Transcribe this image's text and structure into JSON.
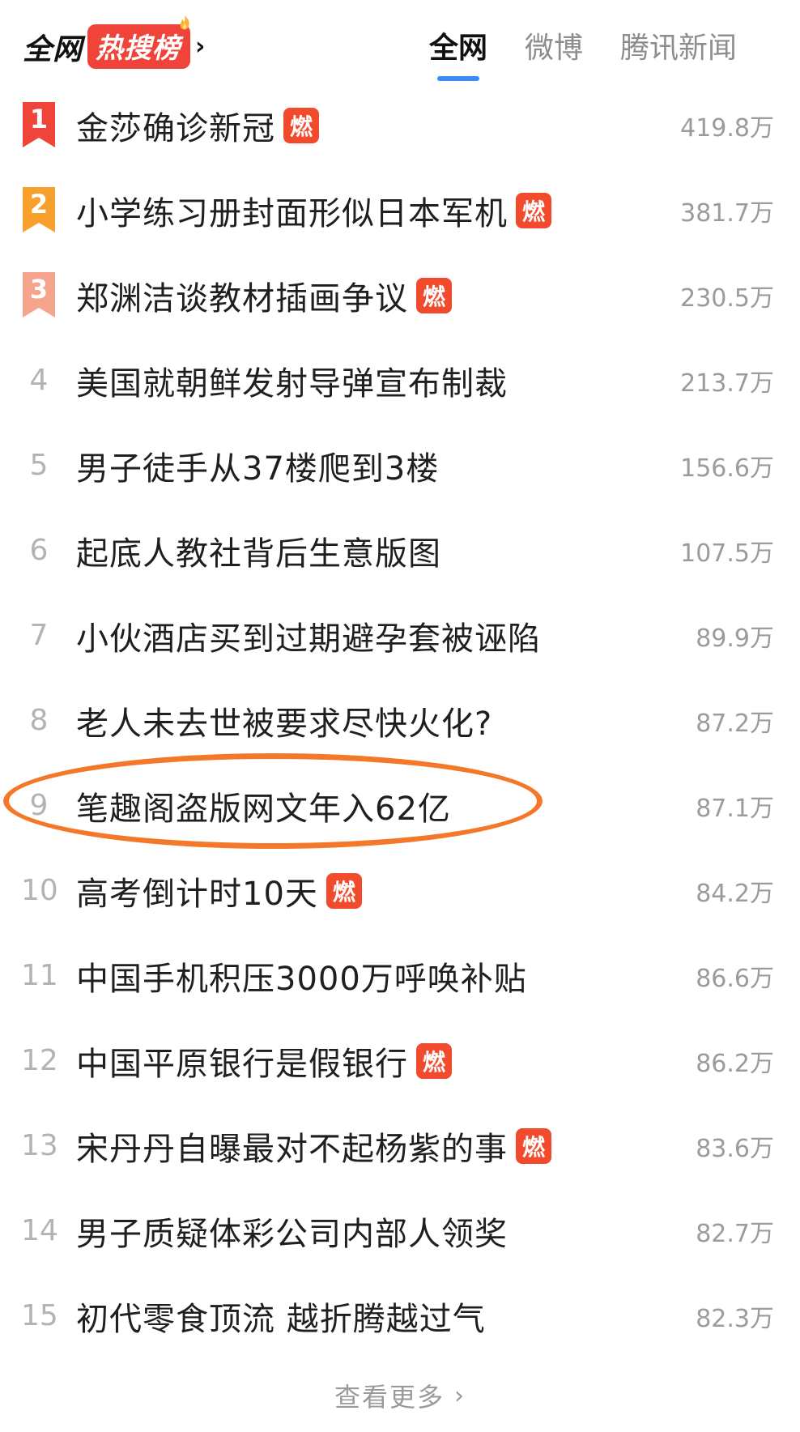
{
  "header": {
    "brand_prefix": "全网",
    "brand_highlight": "热搜榜",
    "brand_chevron": "›",
    "tabs": [
      {
        "label": "全网",
        "active": true
      },
      {
        "label": "微博",
        "active": false
      },
      {
        "label": "腾讯新闻",
        "active": false
      }
    ]
  },
  "badge_label": "燃",
  "colors": {
    "rank1": "#f0433a",
    "rank2": "#f7a12c",
    "rank3": "#f6a48d",
    "hot_badge": "#f24a2c",
    "accent": "#3b8af5",
    "annotation": "#f4782a"
  },
  "items": [
    {
      "rank": "1",
      "title": "金莎确诊新冠",
      "hot": true,
      "count": "419.8万"
    },
    {
      "rank": "2",
      "title": "小学练习册封面形似日本军机",
      "hot": true,
      "count": "381.7万"
    },
    {
      "rank": "3",
      "title": "郑渊洁谈教材插画争议",
      "hot": true,
      "count": "230.5万"
    },
    {
      "rank": "4",
      "title": "美国就朝鲜发射导弹宣布制裁",
      "hot": false,
      "count": "213.7万"
    },
    {
      "rank": "5",
      "title": "男子徒手从37楼爬到3楼",
      "hot": false,
      "count": "156.6万"
    },
    {
      "rank": "6",
      "title": "起底人教社背后生意版图",
      "hot": false,
      "count": "107.5万"
    },
    {
      "rank": "7",
      "title": "小伙酒店买到过期避孕套被诬陷",
      "hot": false,
      "count": "89.9万"
    },
    {
      "rank": "8",
      "title": "老人未去世被要求尽快火化?",
      "hot": false,
      "count": "87.2万"
    },
    {
      "rank": "9",
      "title": "笔趣阁盗版网文年入62亿",
      "hot": false,
      "count": "87.1万"
    },
    {
      "rank": "10",
      "title": "高考倒计时10天",
      "hot": true,
      "count": "84.2万"
    },
    {
      "rank": "11",
      "title": "中国手机积压3000万呼唤补贴",
      "hot": false,
      "count": "86.6万"
    },
    {
      "rank": "12",
      "title": "中国平原银行是假银行",
      "hot": true,
      "count": "86.2万"
    },
    {
      "rank": "13",
      "title": "宋丹丹自曝最对不起杨紫的事",
      "hot": true,
      "count": "83.6万"
    },
    {
      "rank": "14",
      "title": "男子质疑体彩公司内部人领奖",
      "hot": false,
      "count": "82.7万"
    },
    {
      "rank": "15",
      "title": "初代零食顶流 越折腾越过气",
      "hot": false,
      "count": "82.3万"
    }
  ],
  "footer": {
    "more_label": "查看更多",
    "more_chevron": "›"
  }
}
